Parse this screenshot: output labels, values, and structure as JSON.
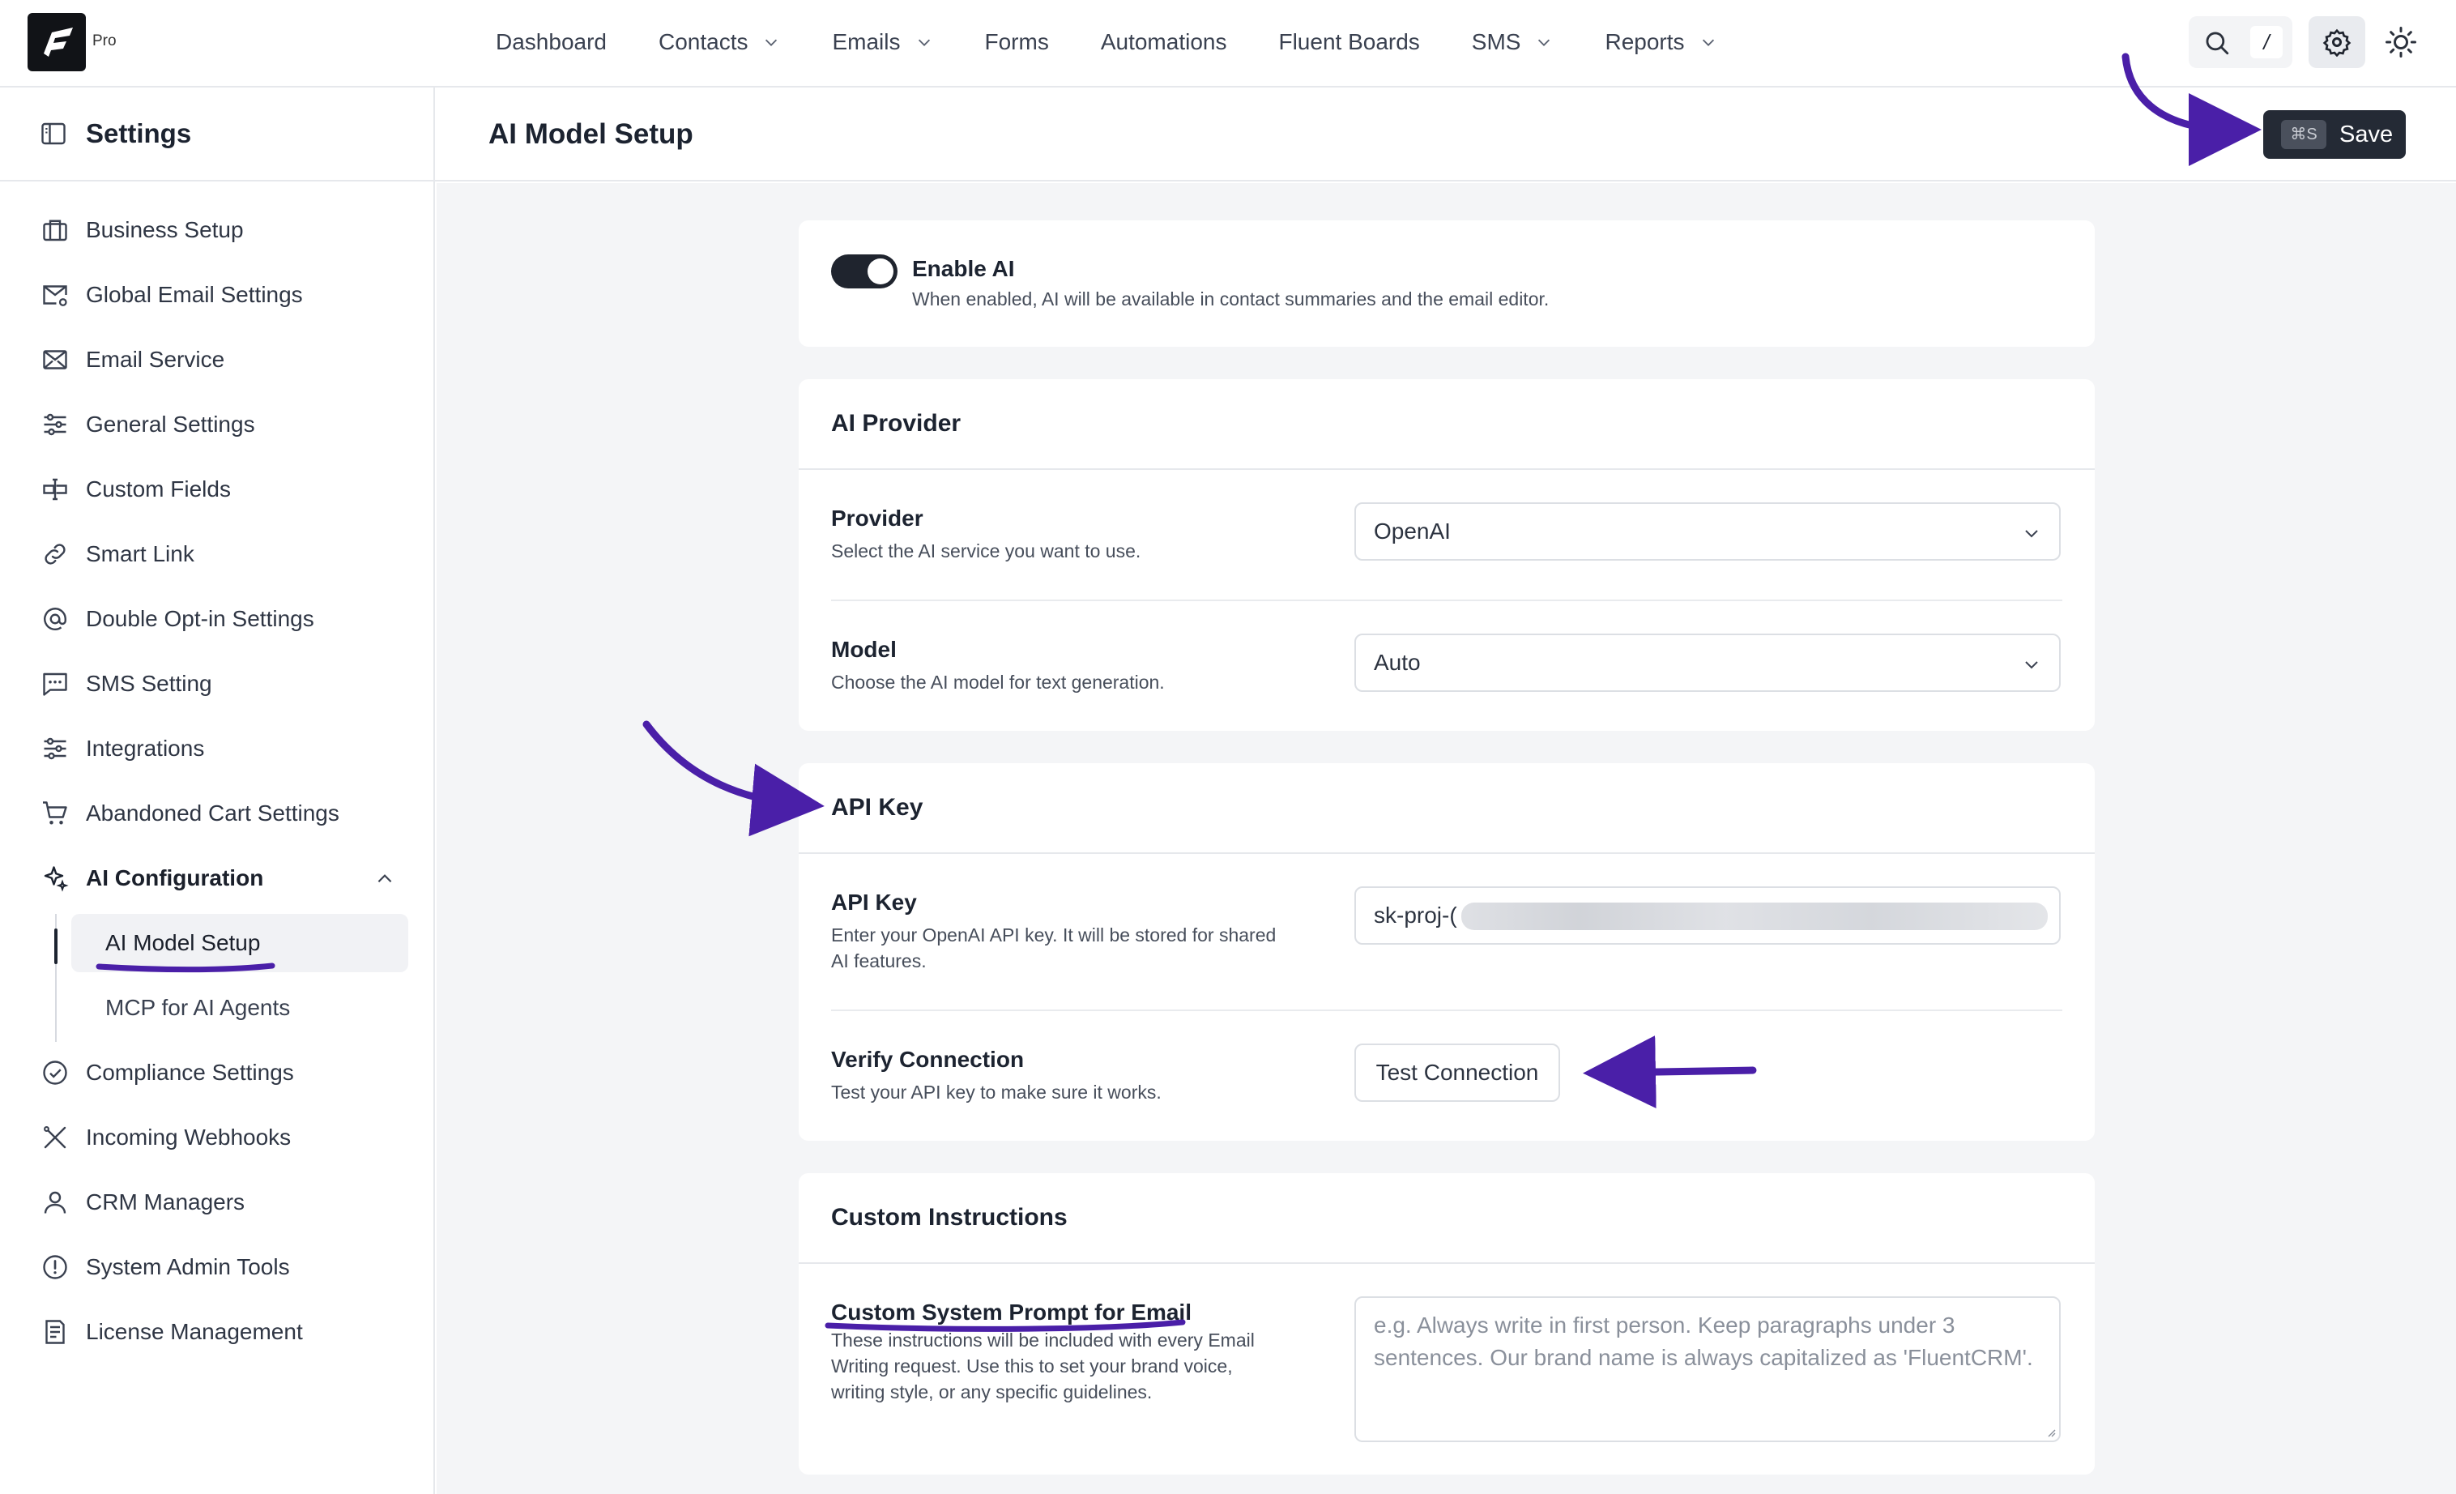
{
  "app": {
    "pro_label": "Pro"
  },
  "nav": {
    "items": [
      {
        "label": "Dashboard",
        "has_dropdown": false
      },
      {
        "label": "Contacts",
        "has_dropdown": true
      },
      {
        "label": "Emails",
        "has_dropdown": true
      },
      {
        "label": "Forms",
        "has_dropdown": false
      },
      {
        "label": "Automations",
        "has_dropdown": false
      },
      {
        "label": "Fluent Boards",
        "has_dropdown": false
      },
      {
        "label": "SMS",
        "has_dropdown": true
      },
      {
        "label": "Reports",
        "has_dropdown": true
      }
    ],
    "search_shortcut": "/"
  },
  "sidebar": {
    "title": "Settings",
    "items": [
      {
        "label": "Business Setup",
        "icon": "briefcase-icon"
      },
      {
        "label": "Global Email Settings",
        "icon": "mail-settings-icon"
      },
      {
        "label": "Email Service",
        "icon": "mail-send-icon"
      },
      {
        "label": "General Settings",
        "icon": "sliders-icon"
      },
      {
        "label": "Custom Fields",
        "icon": "custom-fields-icon"
      },
      {
        "label": "Smart Link",
        "icon": "link-icon"
      },
      {
        "label": "Double Opt-in Settings",
        "icon": "at-sign-icon"
      },
      {
        "label": "SMS Setting",
        "icon": "message-icon"
      },
      {
        "label": "Integrations",
        "icon": "sliders-icon"
      },
      {
        "label": "Abandoned Cart Settings",
        "icon": "cart-icon"
      },
      {
        "label": "AI Configuration",
        "icon": "sparkle-icon"
      }
    ],
    "ai_submenu": [
      {
        "label": "AI Model Setup",
        "active": true
      },
      {
        "label": "MCP for AI Agents",
        "active": false
      }
    ],
    "items_after": [
      {
        "label": "Compliance Settings",
        "icon": "check-circle-icon"
      },
      {
        "label": "Incoming Webhooks",
        "icon": "webhook-icon"
      },
      {
        "label": "CRM Managers",
        "icon": "user-icon"
      },
      {
        "label": "System Admin Tools",
        "icon": "alert-circle-icon"
      },
      {
        "label": "License Management",
        "icon": "license-icon"
      }
    ]
  },
  "main": {
    "title": "AI Model Setup",
    "save": {
      "shortcut": "⌘S",
      "label": "Save"
    },
    "enable_ai": {
      "label": "Enable AI",
      "description": "When enabled, AI will be available in contact summaries and the email editor.",
      "enabled": true
    },
    "provider_card": {
      "title": "AI Provider",
      "provider": {
        "label": "Provider",
        "description": "Select the AI service you want to use.",
        "value": "OpenAI"
      },
      "model": {
        "label": "Model",
        "description": "Choose the AI model for text generation.",
        "value": "Auto"
      }
    },
    "api_card": {
      "title": "API Key",
      "api_key": {
        "label": "API Key",
        "description": "Enter your OpenAI API key. It will be stored for shared AI features.",
        "value_visible": "sk-proj-("
      },
      "verify": {
        "label": "Verify Connection",
        "description": "Test your API key to make sure it works.",
        "button": "Test Connection"
      }
    },
    "instructions_card": {
      "title": "Custom Instructions",
      "prompt": {
        "label": "Custom System Prompt for Email",
        "description": "These instructions will be included with every Email Writing request. Use this to set your brand voice, writing style, or any specific guidelines.",
        "placeholder": "e.g. Always write in first person. Keep paragraphs under 3 sentences. Our brand name is always capitalized as 'FluentCRM'."
      }
    }
  },
  "colors": {
    "accent_annotation": "#4a1fa8",
    "dark": "#1f242e",
    "content_bg": "#f4f5f7"
  }
}
